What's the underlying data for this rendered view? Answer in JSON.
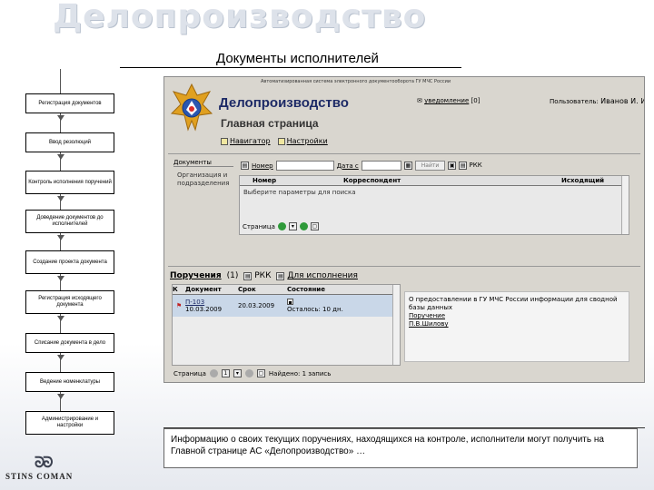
{
  "slide": {
    "title": "Делопроизводство",
    "subtitle": "Документы исполнителей",
    "caption": "Информацию о своих текущих поручениях, находящихся на контроле, исполнители могут получить на Главной странице АС «Делопроизводство» …",
    "logo": "STINS COMAN"
  },
  "workflow": [
    "Регистрация документов",
    "Ввод резолюций",
    "Контроль исполнения поручений",
    "Доведение документов до исполнителей",
    "Создание проекта документа",
    "Регистрация исходящего документа",
    "Списание документа в дело",
    "Ведение номенклатуры",
    "Администрирование и настройки"
  ],
  "app": {
    "topbar": "Автоматизированная система электронного документооборота ГУ МЧС России",
    "title": "Делопроизводство",
    "page_title": "Главная страница",
    "nav": {
      "navigator": "Навигатор",
      "settings": "Настройки"
    },
    "top_links": {
      "notifications": "уведомление"
    },
    "user_label": "Пользователь:",
    "user_name": "Иванов И. И.",
    "documents": {
      "label": "Документы",
      "category": "Организация и подразделения",
      "filter_number": "Номер",
      "filter_date": "Дата с",
      "filter_button": "Найти",
      "rkk": "РКК",
      "columns": [
        "Номер",
        "Корреспондент",
        "Исходящий"
      ],
      "note": "Выберите параметры для поиска",
      "pager_label": "Страница"
    },
    "assignments": {
      "title": "Поручения",
      "count": "(1)",
      "rkk": "РКК",
      "for_execution": "Для исполнения",
      "columns": [
        "К",
        "Документ",
        "Срок",
        "Состояние"
      ],
      "row": {
        "doc_number": "П-103",
        "doc_date": "10.03.2009",
        "deadline": "20.03.2009",
        "status": "Осталось: 10 дн."
      },
      "detail_text": "О предоставлении в ГУ МЧС России информации для сводной базы данных",
      "detail_link1": "Поручение",
      "detail_link2": "П.В.Шилову",
      "pager_label": "Страница",
      "page": "1",
      "found": "Найдено: 1 запись"
    }
  },
  "colors": {
    "title_bg": "#dde2ea",
    "app_title": "#1d2a66",
    "selected_row": "#c9d7e8"
  }
}
